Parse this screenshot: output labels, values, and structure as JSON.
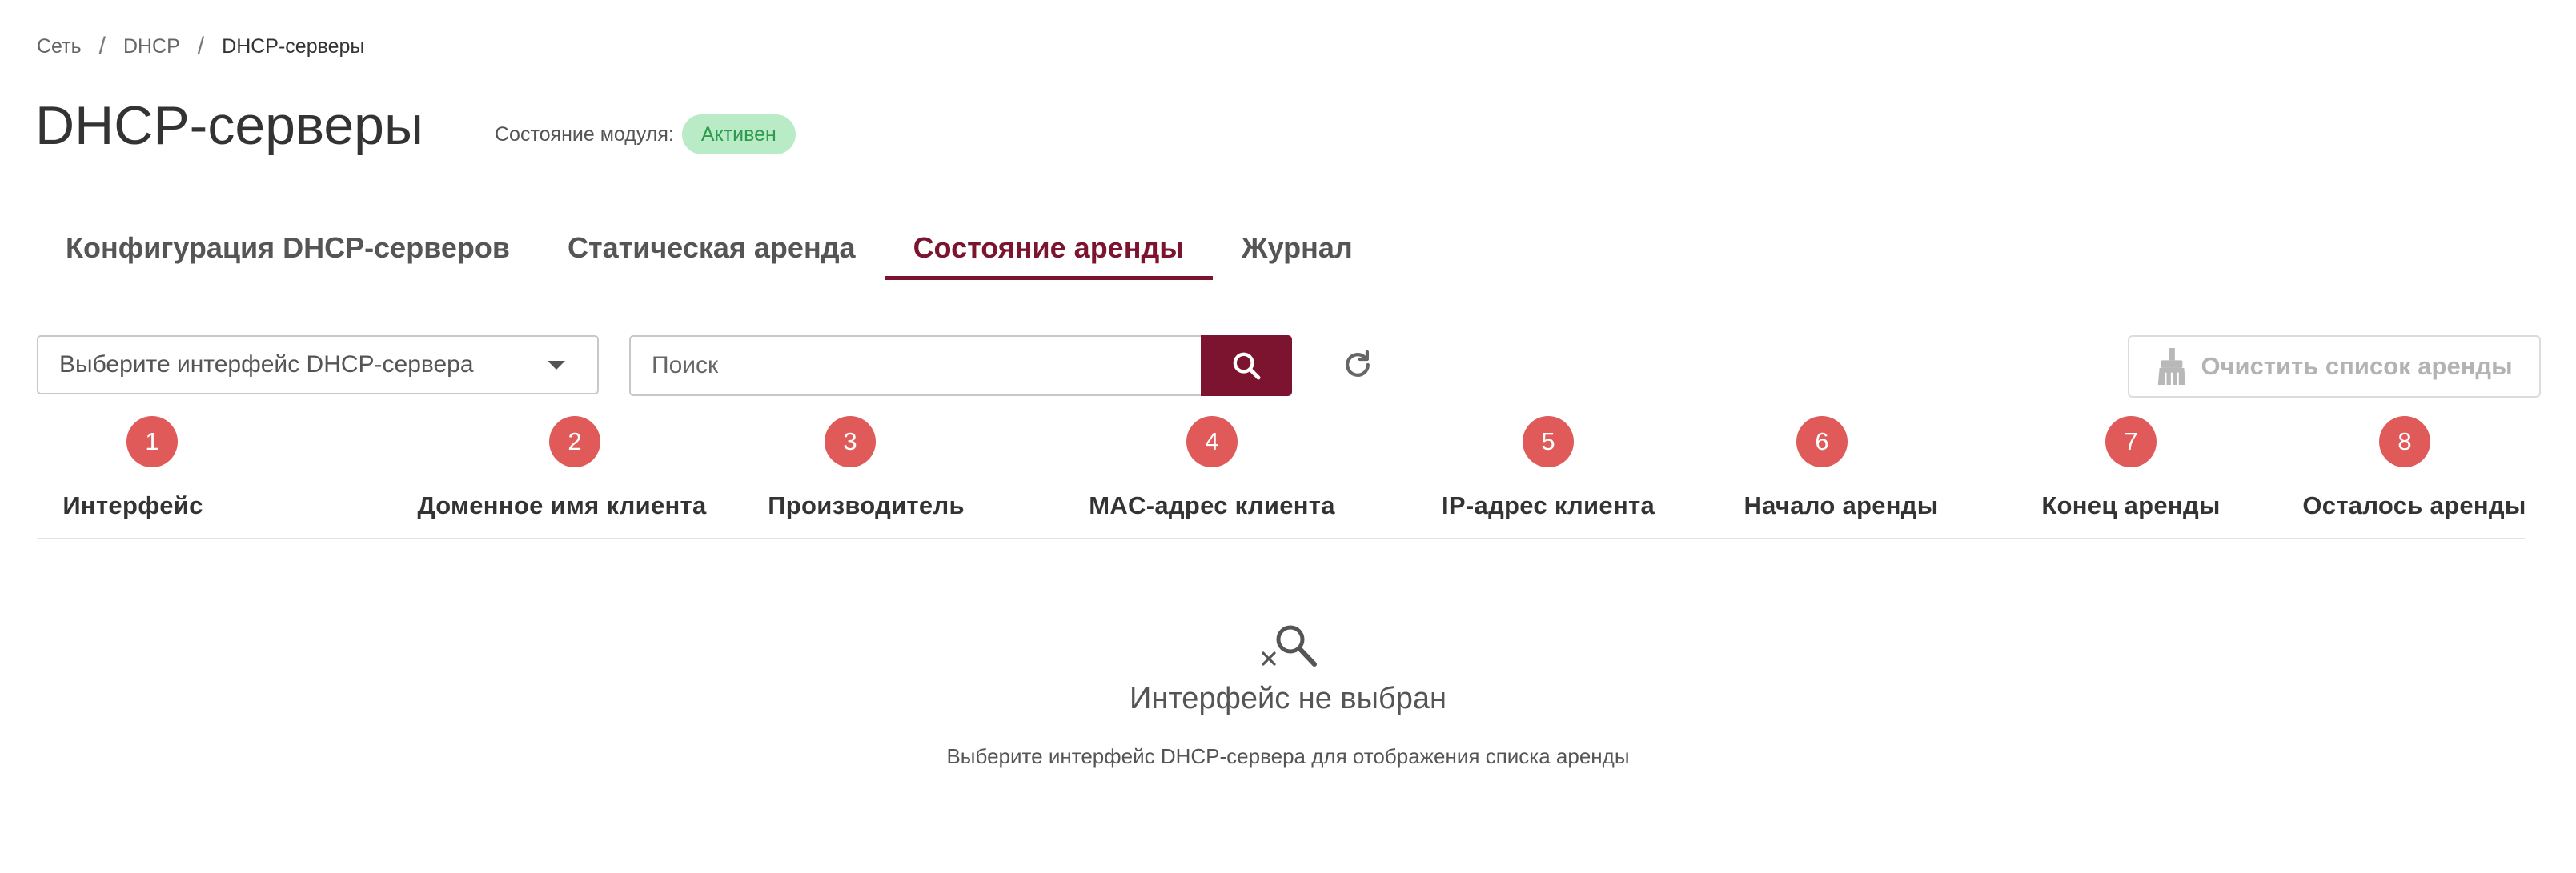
{
  "breadcrumb": {
    "items": [
      "Сеть",
      "DHCP",
      "DHCP-серверы"
    ],
    "separator": "/"
  },
  "page": {
    "title": "DHCP-серверы",
    "module_state_label": "Состояние модуля:",
    "module_state_value": "Активен"
  },
  "tabs": [
    {
      "label": "Конфигурация DHCP-серверов",
      "active": false
    },
    {
      "label": "Статическая аренда",
      "active": false
    },
    {
      "label": "Состояние аренды",
      "active": true
    },
    {
      "label": "Журнал",
      "active": false
    }
  ],
  "toolbar": {
    "interface_select_placeholder": "Выберите интерфейс DHCP-сервера",
    "search_placeholder": "Поиск",
    "search_value": "",
    "clear_button_label": "Очистить список аренды",
    "clear_button_enabled": false
  },
  "table": {
    "columns": [
      {
        "number": "1",
        "label": "Интерфейс"
      },
      {
        "number": "2",
        "label": "Доменное имя клиента"
      },
      {
        "number": "3",
        "label": "Производитель"
      },
      {
        "number": "4",
        "label": "MAC-адрес клиента"
      },
      {
        "number": "5",
        "label": "IP-адрес клиента"
      },
      {
        "number": "6",
        "label": "Начало аренды"
      },
      {
        "number": "7",
        "label": "Конец аренды"
      },
      {
        "number": "8",
        "label": "Осталось аренды"
      }
    ],
    "rows": []
  },
  "empty_state": {
    "icon": "search-off-icon",
    "title": "Интерфейс не выбран",
    "hint": "Выберите интерфейс DHCP-сервера для отображения списка аренды"
  },
  "colors": {
    "accent": "#7c1430",
    "badge_bg": "#b9ebc6",
    "badge_text": "#2e9a4e",
    "column_number_badge": "#e05a5a",
    "disabled_text": "#b3b3b3"
  },
  "icons": {
    "dropdown": "chevron-down-icon",
    "search": "search-icon",
    "refresh": "refresh-icon",
    "clear": "broom-icon"
  }
}
